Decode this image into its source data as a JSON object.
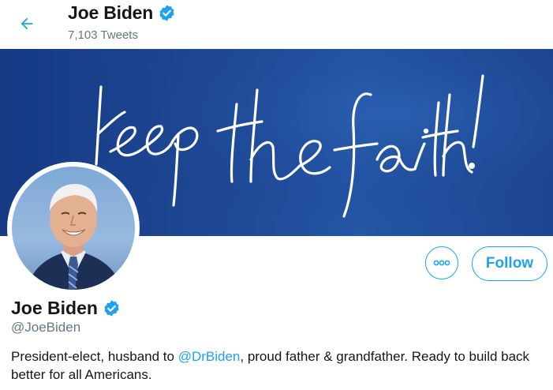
{
  "header": {
    "name": "Joe Biden",
    "tweet_count": "7,103 Tweets",
    "back_icon": "arrow-left-icon",
    "verified_icon": "verified-badge-icon"
  },
  "banner": {
    "text": "Keep the faith!",
    "colors": {
      "dark": "#163a84",
      "mid": "#2456a6",
      "script": "#ffffff"
    }
  },
  "profile": {
    "name": "Joe Biden",
    "handle": "@JoeBiden",
    "more_icon": "more-dots-icon",
    "follow_label": "Follow",
    "bio": {
      "before_mention": "President-elect, husband to ",
      "mention": "@DrBiden",
      "after_mention": ", proud father & grandfather. Ready to build back better for all Americans."
    }
  },
  "colors": {
    "accent": "#1da1f2",
    "secondary_text": "#657786",
    "primary_text": "#14171a"
  }
}
